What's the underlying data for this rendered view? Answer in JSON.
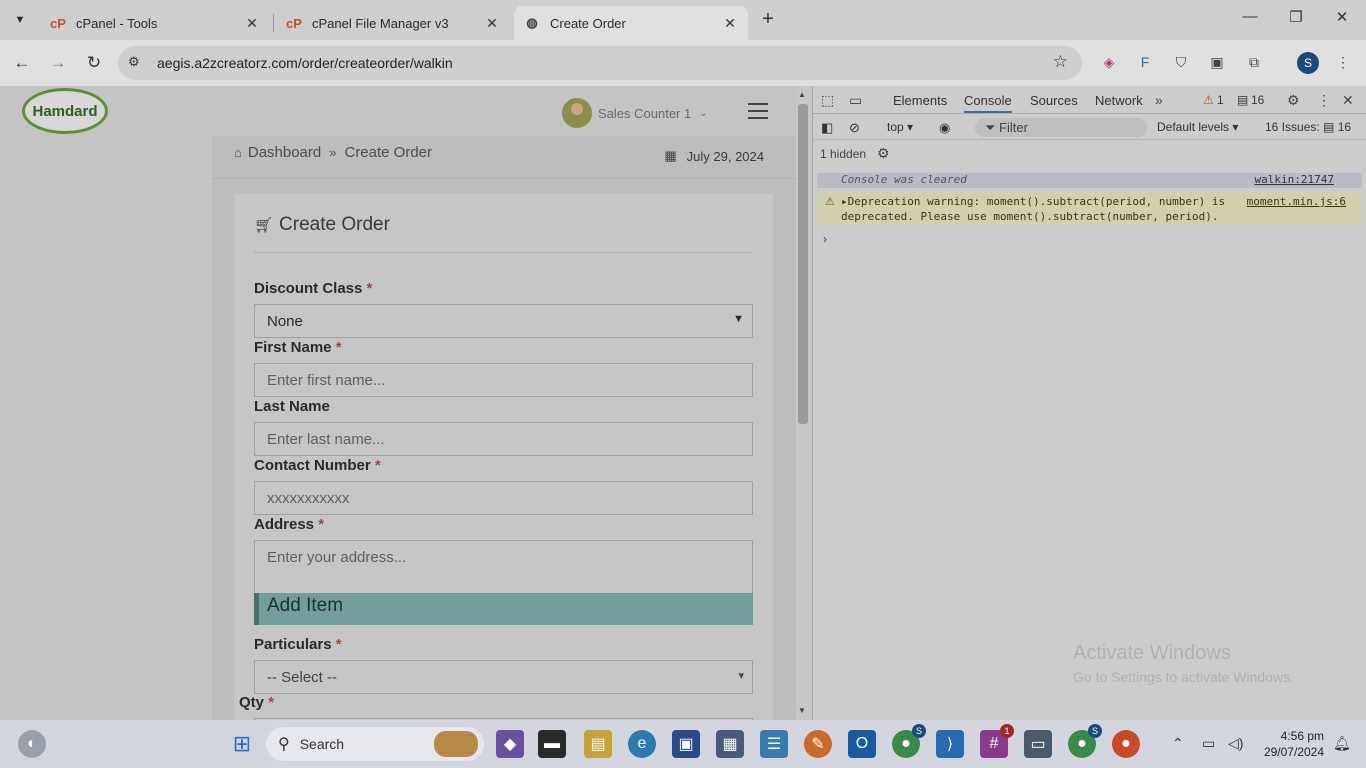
{
  "browser": {
    "tabs": [
      {
        "label": "cPanel - Tools",
        "favicon": "cpanel-icon"
      },
      {
        "label": "cPanel File Manager v3",
        "favicon": "cpanel-icon"
      },
      {
        "label": "Create Order",
        "favicon": "globe-icon"
      }
    ],
    "url": "aegis.a2zcreatorz.com/order/createorder/walkin",
    "profile_initial": "S"
  },
  "app": {
    "logo_text": "Hamdard",
    "user_name": "Sales Counter 1",
    "breadcrumb": [
      "Dashboard",
      "Create Order"
    ],
    "date": "July 29, 2024",
    "card_title": "Create Order",
    "form": {
      "discount_class": {
        "label": "Discount Class",
        "value": "None"
      },
      "first_name": {
        "label": "First Name",
        "placeholder": "Enter first name..."
      },
      "last_name": {
        "label": "Last Name",
        "placeholder": "Enter last name..."
      },
      "contact_number": {
        "label": "Contact Number",
        "placeholder": "xxxxxxxxxxx"
      },
      "address": {
        "label": "Address",
        "placeholder": "Enter your address..."
      },
      "add_item_heading": "Add Item",
      "particulars": {
        "label": "Particulars",
        "value": "-- Select --"
      },
      "qty": {
        "label": "Qty"
      },
      "required_mark": "*"
    }
  },
  "devtools": {
    "tabs": [
      "Elements",
      "Console",
      "Sources",
      "Network"
    ],
    "warning_count": "1",
    "message_count": "16",
    "context": "top",
    "filter_placeholder": "Filter",
    "levels": "Default levels",
    "issues": "16 Issues:",
    "issues_count": "16",
    "hidden": "1 hidden",
    "messages": {
      "cleared": "Console was cleared",
      "cleared_source": "walkin:21747",
      "warning_line1": "Deprecation warning: moment().subtract(period, number) is",
      "warning_line2": "deprecated. Please use moment().subtract(number, period).",
      "warning_source": "moment.min.js:6"
    }
  },
  "watermark": {
    "line1": "Activate Windows",
    "line2": "Go to Settings to activate Windows."
  },
  "taskbar": {
    "search_label": "Search",
    "time": "4:56 pm",
    "date": "29/07/2024",
    "badges": {
      "chrome": "S",
      "slack": "1",
      "chrome2": "S"
    }
  }
}
